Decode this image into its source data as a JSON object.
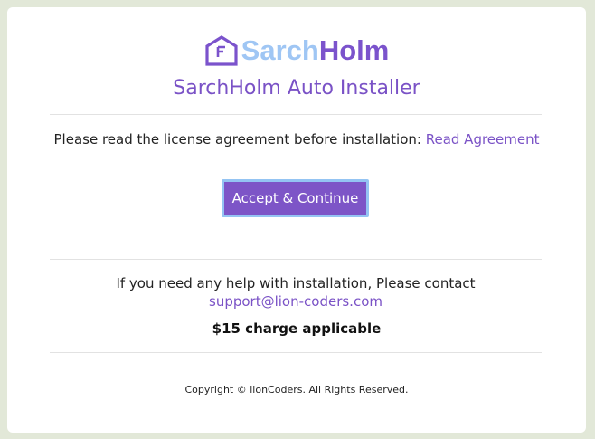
{
  "logo": {
    "part1": "Sarch",
    "part2": "Holm"
  },
  "title": "SarchHolm Auto Installer",
  "license": {
    "text": "Please read the license agreement before installation: ",
    "link_label": "Read Agreement"
  },
  "accept_button_label": "Accept & Continue",
  "help": {
    "text": "If you need any help with installation, Please contact ",
    "email": "support@lion-coders.com"
  },
  "charge": "$15 charge applicable",
  "copyright": "Copyright © lionCoders. All Rights Reserved.",
  "colors": {
    "accent": "#7d55c7",
    "logo_light": "#9fc6f4",
    "button_focus_ring": "#94c4f3",
    "page_background": "#e2e8d8"
  }
}
